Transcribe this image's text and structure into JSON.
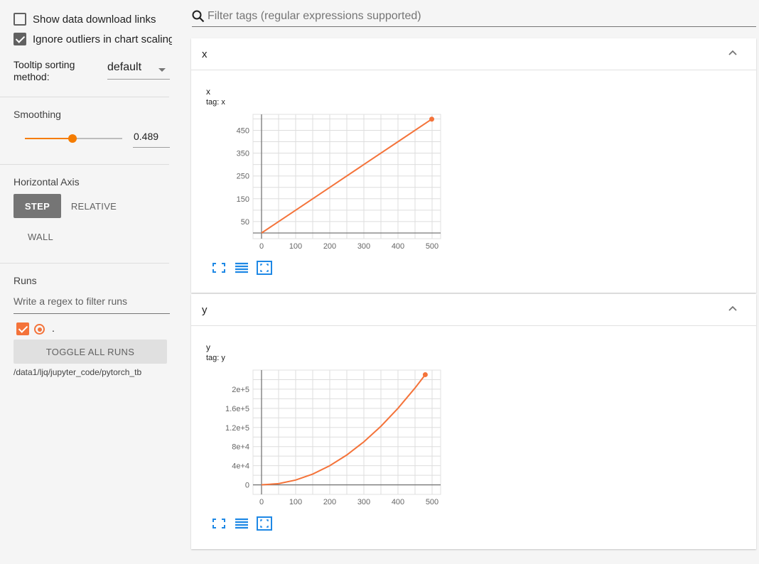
{
  "sidebar": {
    "show_download_label": "Show data download links",
    "ignore_outliers_label": "Ignore outliers in chart scaling",
    "tooltip_label": "Tooltip sorting method:",
    "tooltip_value": "default",
    "smoothing_title": "Smoothing",
    "smoothing_value": "0.489",
    "smoothing_fraction": 0.489,
    "horizontal_axis_title": "Horizontal Axis",
    "axis_step": "STEP",
    "axis_relative": "RELATIVE",
    "axis_wall": "WALL",
    "runs_title": "Runs",
    "runs_filter_placeholder": "Write a regex to filter runs",
    "run_name": ".",
    "toggle_all_runs": "TOGGLE ALL RUNS",
    "run_path": "/data1/ljq/jupyter_code/pytorch_tb"
  },
  "filter": {
    "placeholder": "Filter tags (regular expressions supported)"
  },
  "cards": [
    {
      "header": "x",
      "title": "x",
      "tag": "tag: x"
    },
    {
      "header": "y",
      "title": "y",
      "tag": "tag: y"
    }
  ],
  "colors": {
    "accent": "#f57c00",
    "series": "#f4733a",
    "icon": "#1e88e5"
  },
  "chart_data": [
    {
      "type": "line",
      "title": "x",
      "subtitle": "tag: x",
      "x": [
        0,
        100,
        200,
        300,
        400,
        499
      ],
      "series": [
        {
          "values": [
            0,
            100,
            200,
            300,
            400,
            499
          ]
        }
      ],
      "xticks": [
        "0",
        "100",
        "200",
        "300",
        "400",
        "500"
      ],
      "yticks": [
        "50",
        "150",
        "250",
        "350",
        "450"
      ],
      "ytick_values": [
        50,
        150,
        250,
        350,
        450
      ],
      "xlim": [
        -25,
        525
      ],
      "ylim": [
        -25,
        520
      ],
      "grid": true
    },
    {
      "type": "line",
      "title": "y",
      "subtitle": "tag: y",
      "x": [
        0,
        50,
        100,
        150,
        200,
        250,
        300,
        350,
        400,
        450,
        480
      ],
      "series": [
        {
          "values": [
            0,
            2500,
            10000,
            22500,
            40000,
            62500,
            90000,
            122500,
            160000,
            202500,
            230400
          ]
        }
      ],
      "xticks": [
        "0",
        "100",
        "200",
        "300",
        "400",
        "500"
      ],
      "yticks": [
        "0",
        "4e+4",
        "8e+4",
        "1.2e+5",
        "1.6e+5",
        "2e+5"
      ],
      "ytick_values": [
        0,
        40000,
        80000,
        120000,
        160000,
        200000
      ],
      "xlim": [
        -25,
        525
      ],
      "ylim": [
        -20000,
        240000
      ],
      "grid": true
    }
  ]
}
